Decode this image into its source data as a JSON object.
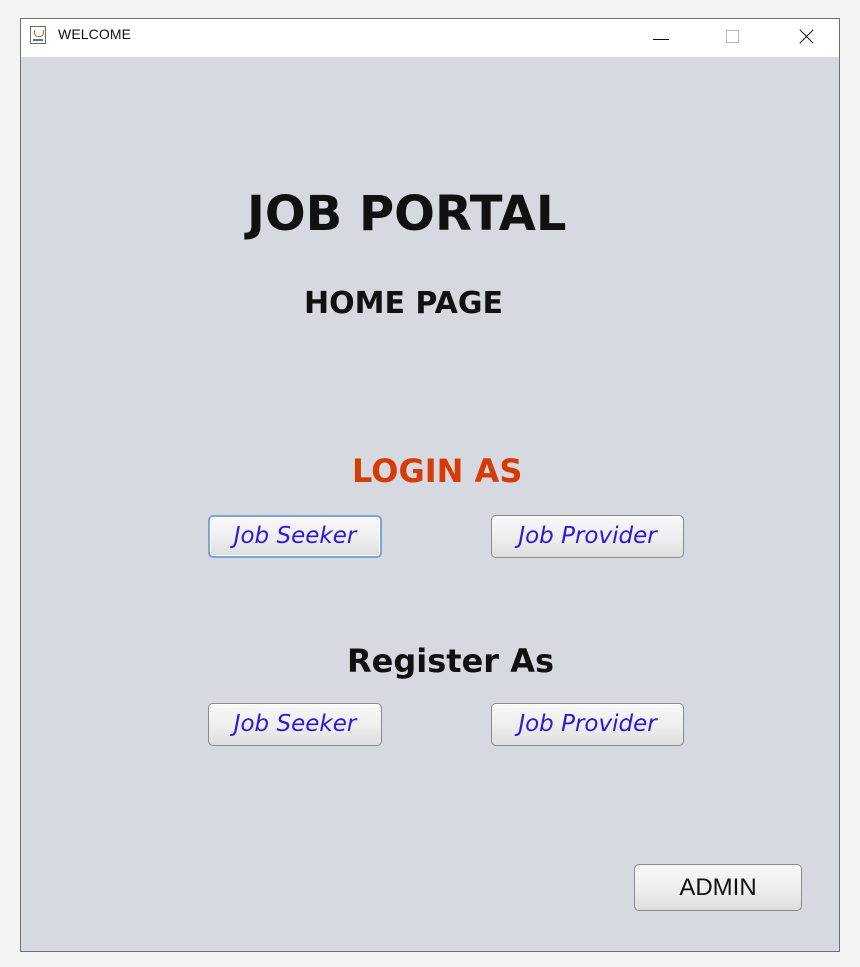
{
  "window": {
    "title": "WELCOME",
    "controls": {
      "minimize_icon": "minimize-icon",
      "maximize_icon": "maximize-icon",
      "close_icon": "close-icon"
    }
  },
  "content": {
    "title": "JOB PORTAL",
    "subtitle": "HOME PAGE",
    "login": {
      "heading": "LOGIN AS",
      "job_seeker": "Job Seeker",
      "job_provider": "Job Provider"
    },
    "register": {
      "heading": "Register As",
      "job_seeker": "Job Seeker",
      "job_provider": "Job Provider"
    },
    "admin_button": "ADMIN"
  },
  "colors": {
    "background": "#d6d9df",
    "login_heading": "#d43b06",
    "button_text": "#2b19d8",
    "focused_border": "#7aa6cf"
  },
  "icons": {
    "app": "java-cup-icon"
  }
}
